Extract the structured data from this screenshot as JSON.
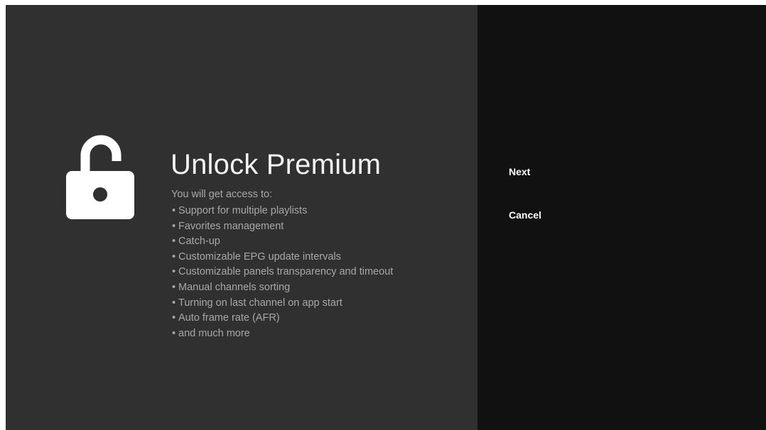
{
  "premium": {
    "title": "Unlock Premium",
    "intro": "You will get access to:",
    "features": [
      "Support for multiple playlists",
      "Favorites management",
      "Catch-up",
      "Customizable EPG update intervals",
      "Customizable panels transparency and timeout",
      "Manual channels sorting",
      "Turning on last channel on app start",
      "Auto frame rate (AFR)",
      "and much more"
    ]
  },
  "actions": {
    "next_label": "Next",
    "cancel_label": "Cancel"
  },
  "icons": {
    "lock": "lock-open-icon"
  },
  "colors": {
    "left_panel_bg": "#303030",
    "right_panel_bg": "#111111",
    "title_text": "#f2f2f2",
    "body_text": "#a8a8a8",
    "action_text": "#ffffff"
  }
}
